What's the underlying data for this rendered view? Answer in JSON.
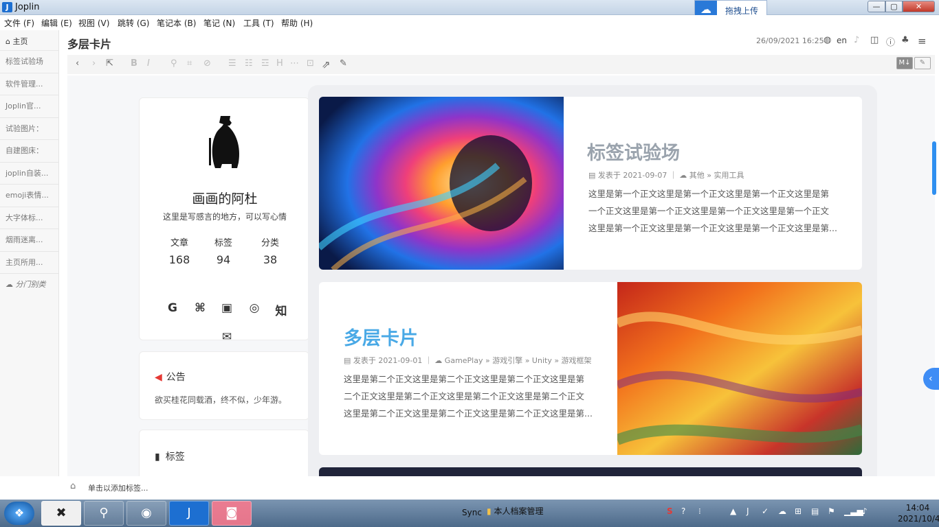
{
  "window": {
    "title": "Joplin",
    "app_icon_glyph": "J"
  },
  "upload_pill": {
    "label": "拖拽上传",
    "icon": "cloud-upload-icon"
  },
  "window_controls": {
    "minimize": "—",
    "maximize": "▢",
    "close": "✕"
  },
  "menubar": [
    "文件 (F)",
    "编辑 (E)",
    "视图 (V)",
    "跳转 (G)",
    "笔记本 (B)",
    "笔记 (N)",
    "工具 (T)",
    "帮助 (H)"
  ],
  "sidebar": {
    "home_label": "主页",
    "notes": [
      "标签试验场",
      "软件管理...",
      "Joplin官...",
      "试验图片：",
      "自建图床：",
      "joplin自装...",
      "emoji表情...",
      "大字体标...",
      "烟雨迷离...",
      "主页所用...",
      "分门别类"
    ]
  },
  "note": {
    "title": "多层卡片",
    "date": "26/09/2021 16:25",
    "language": "en"
  },
  "toolbar": {
    "mode_markdown": "M↓",
    "mode_editor": "✎"
  },
  "profile": {
    "name": "画画的阿杜",
    "description": "这里是写感言的地方，可以写心情",
    "stats": [
      {
        "label": "文章",
        "value": "168"
      },
      {
        "label": "标签",
        "value": "94"
      },
      {
        "label": "分类",
        "value": "38"
      }
    ],
    "social_icons": [
      {
        "name": "google-icon",
        "glyph": "G"
      },
      {
        "name": "github-icon",
        "glyph": "⌘"
      },
      {
        "name": "bilibili-icon",
        "glyph": "▣"
      },
      {
        "name": "netease-music-icon",
        "glyph": "◎"
      },
      {
        "name": "zhihu-icon",
        "glyph": "知"
      },
      {
        "name": "email-icon",
        "glyph": "✉"
      }
    ]
  },
  "notice": {
    "title": "公告",
    "text": "欲买桂花同载酒，终不似，少年游。"
  },
  "tags_widget": {
    "title": "标签"
  },
  "posts": [
    {
      "title": "标签试验场",
      "title_color": "#9aa3ad",
      "meta": "▤ 发表于 2021-09-07 ｜ ☁ 其他 » 实用工具",
      "lines": [
        "这里是第一个正文这里是第一个正文这里是第一个正文这里是第",
        "一个正文这里是第一个正文这里是第一个正文这里是第一个正文",
        "这里是第一个正文这里是第一个正文这里是第一个正文这里是第..."
      ]
    },
    {
      "title": "多层卡片",
      "title_color": "#49a9e6",
      "meta": "▤ 发表于 2021-09-01 ｜ ☁ GamePlay » 游戏引擎 » Unity » 游戏框架",
      "lines": [
        "这里是第二个正文这里是第二个正文这里是第二个正文这里是第",
        "二个正文这里是第二个正文这里是第二个正文这里是第二个正文",
        "这里是第二个正文这里是第二个正文这里是第二个正文这里是第..."
      ]
    }
  ],
  "tagbar": {
    "placeholder": "单击以添加标签..."
  },
  "taskbar": {
    "sync_label": "Sync",
    "folder_label": "本人档案管理",
    "time": "14:04",
    "date": "2021/10/4"
  }
}
